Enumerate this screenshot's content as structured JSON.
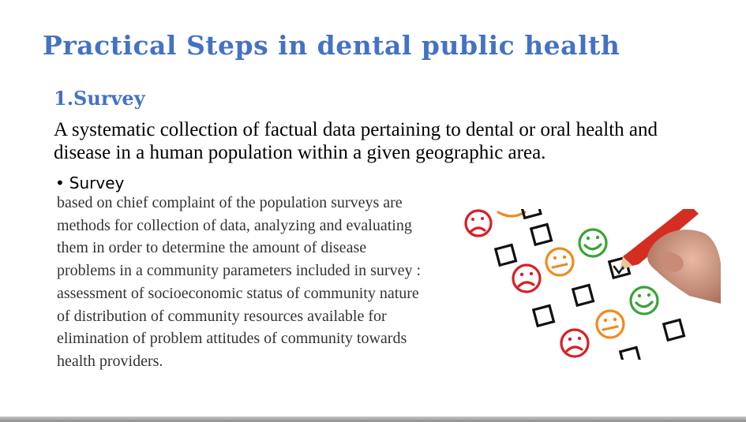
{
  "slide": {
    "title": "Practical Steps in dental public health",
    "section_heading": "1.Survey",
    "definition": "A systematic collection of factual data pertaining to dental or oral health and disease in a human population within a given geographic area.",
    "bullet": "Survey",
    "body_text": "based on chief complaint of the population surveys are methods for collection of data, analyzing and evaluating them in order to determine the amount of disease problems in a community parameters included in survey : assessment of socioeconomic status of community nature of distribution of community resources available for elimination of problem attitudes of community towards health providers."
  },
  "image": {
    "description_icon": "satisfaction-survey-checklist-icon",
    "colors": {
      "sad": "#d81e27",
      "neutral": "#f08a1e",
      "happy": "#3aa336",
      "pencil": "#d42e23",
      "title": "#4472C4"
    }
  }
}
